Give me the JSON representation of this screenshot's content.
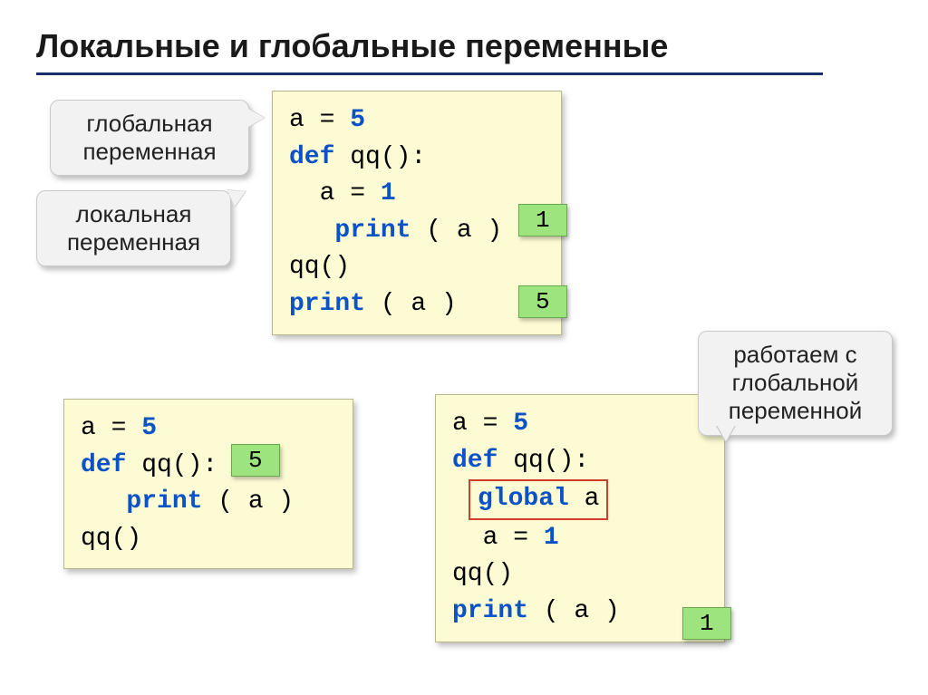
{
  "title": "Локальные и глобальные переменные",
  "callouts": {
    "global_var": {
      "line1": "глобальная",
      "line2": "переменная"
    },
    "local_var": {
      "line1": "локальная",
      "line2": "переменная"
    },
    "work_global": {
      "line1": "работаем с",
      "line2": "глобальной",
      "line3": "переменной"
    }
  },
  "code1": {
    "l1a": "a",
    "l1b": " = ",
    "l1c": "5",
    "l2a": "def",
    "l2b": " qq():",
    "l3a": "  a",
    "l3b": " = ",
    "l3c": "1",
    "l4a": "   print",
    "l4b": " ( a )",
    "l5": "qq()",
    "l6a": "print",
    "l6b": " ( a )",
    "res1": "1",
    "res2": "5"
  },
  "code2": {
    "l1a": "a",
    "l1b": " = ",
    "l1c": "5",
    "l2a": "def",
    "l2b": " qq():",
    "l3a": "   print",
    "l3b": " ( a )",
    "l4": "qq()",
    "res": "5"
  },
  "code3": {
    "l1a": "a",
    "l1b": " = ",
    "l1c": "5",
    "l2a": "def",
    "l2b": " qq():",
    "l3a": "global",
    "l3b": " a",
    "l4a": "  a",
    "l4b": " = ",
    "l4c": "1",
    "l5": "qq()",
    "l6a": "print",
    "l6b": " ( a )",
    "res": "1"
  }
}
